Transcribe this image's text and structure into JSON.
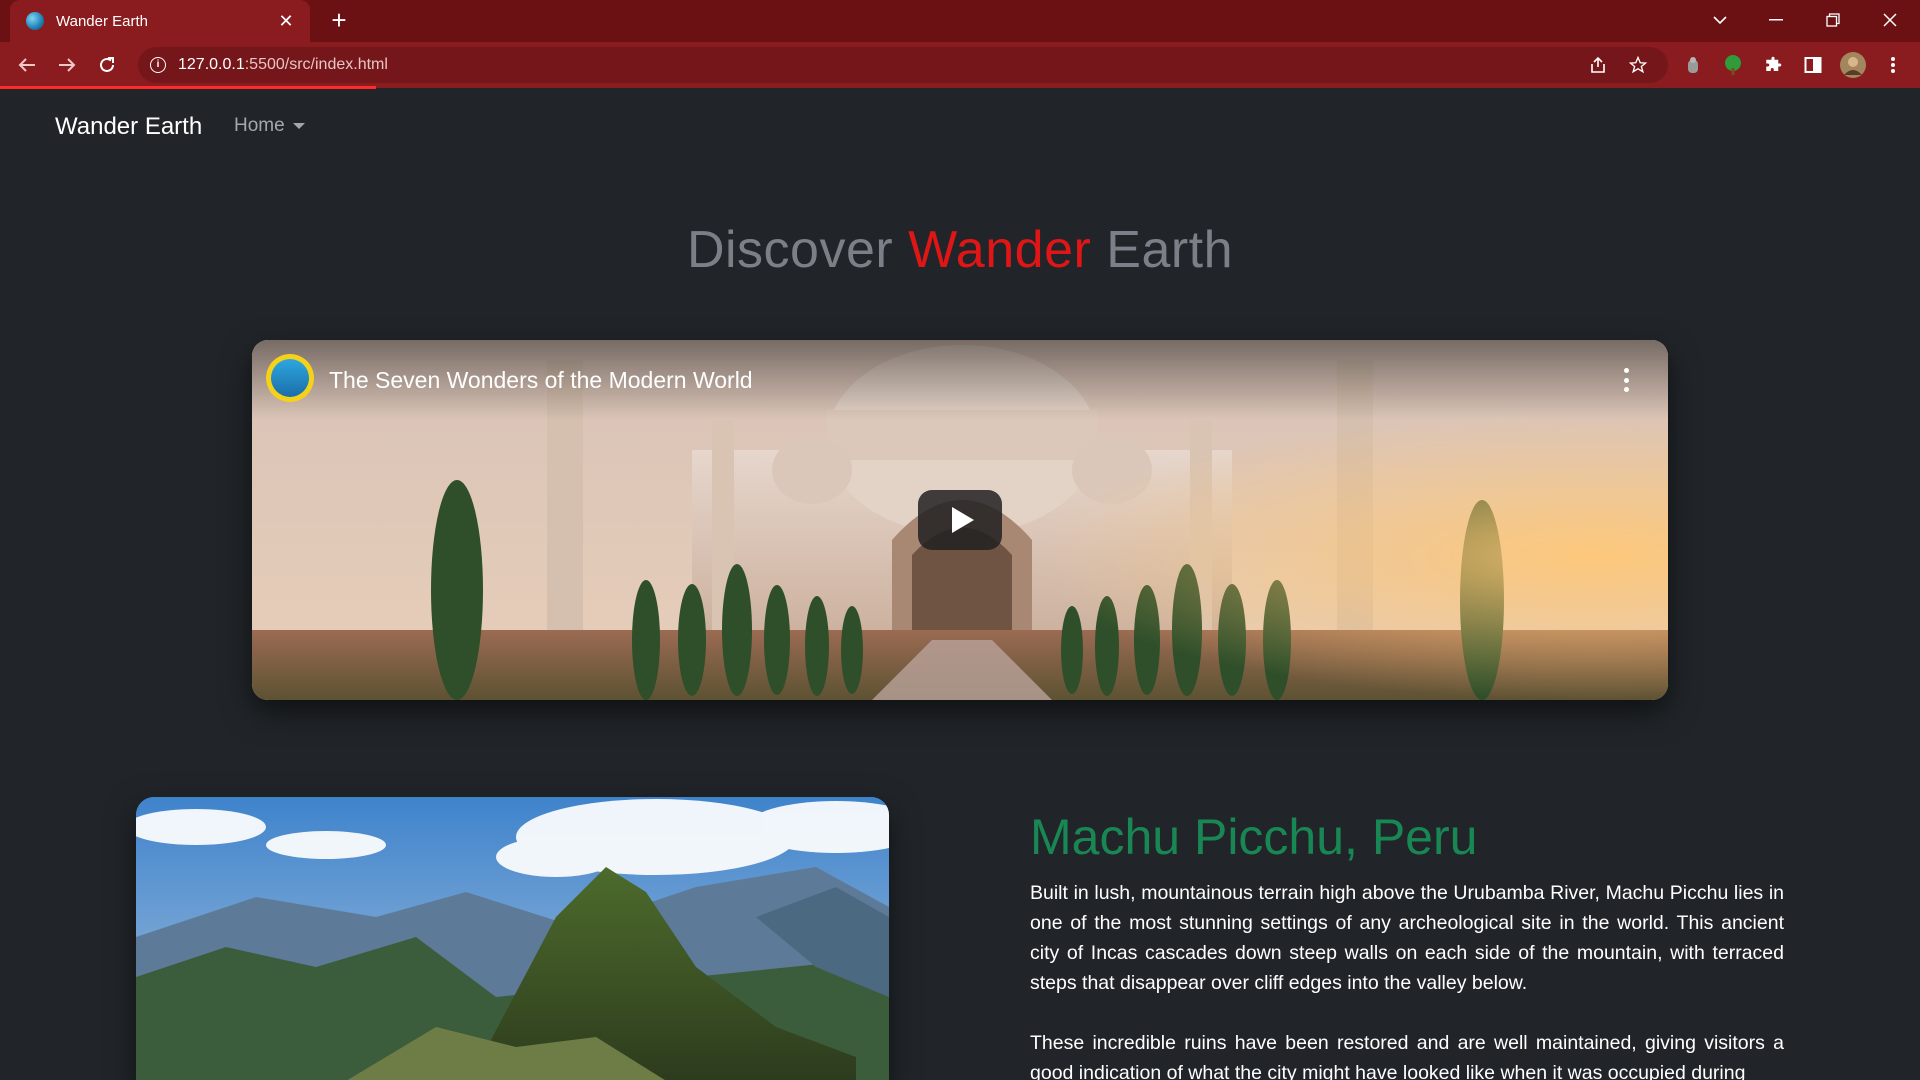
{
  "browser": {
    "tab_title": "Wander Earth",
    "url_host": "127.0.0.1",
    "url_path": ":5500/src/index.html"
  },
  "navbar": {
    "brand": "Wander Earth",
    "home_label": "Home"
  },
  "hero": {
    "title_prefix": "Discover ",
    "title_accent": "Wander",
    "title_suffix": " Earth"
  },
  "video": {
    "title": "The Seven Wonders of the Modern World"
  },
  "section": {
    "title": "Machu Picchu, Peru",
    "paragraph1": "Built in lush, mountainous terrain high above the Urubamba River, Machu Picchu lies in one of the most stunning settings of any archeological site in the world. This ancient city of Incas cascades down steep walls on each side of the mountain, with terraced steps that disappear over cliff edges into the valley below.",
    "paragraph2": "These incredible ruins have been restored and are well maintained, giving visitors a good indication of what the city might have looked like when it was occupied during"
  },
  "colors": {
    "accent_red": "#e01616",
    "section_green": "#198754",
    "page_bg": "#212529",
    "browser_frame": "#8a1c1f"
  },
  "icons": [
    "globe-favicon-icon",
    "close-icon",
    "plus-icon",
    "back-icon",
    "forward-icon",
    "reload-icon",
    "info-icon",
    "share-icon",
    "star-icon",
    "extension-icon",
    "sidepanel-icon",
    "profile-avatar-icon",
    "more-vert-icon",
    "play-icon",
    "caret-down-icon"
  ]
}
